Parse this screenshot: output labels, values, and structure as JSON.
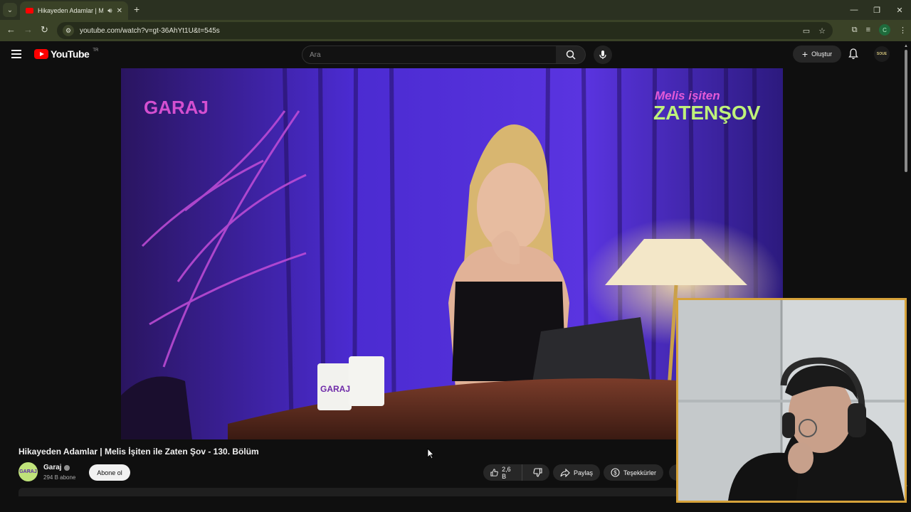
{
  "browser": {
    "tab_title": "Hikayeden Adamlar | Melis",
    "new_tab_icon": "plus-icon",
    "url": "youtube.com/watch?v=gt-36AhYt1U&t=545s",
    "profile_initial": "C"
  },
  "youtube": {
    "logo_text": "YouTube",
    "country_code": "TR",
    "search_placeholder": "Ara",
    "create_label": "Oluştur",
    "account_avatar_text": "SOUE",
    "brand_color": "#ff0000"
  },
  "video": {
    "overlay_left": "GARAJ",
    "overlay_right_top": "Melis işiten",
    "overlay_right_bottom": "ZATENŞOV",
    "mug_text": "GARAJ",
    "title": "Hikayeden Adamlar | Melis İşiten ile Zaten Şov - 130. Bölüm"
  },
  "channel": {
    "avatar_text": "GARAJ",
    "name": "Garaj",
    "subscribers": "294 B abone",
    "subscribe_label": "Abone ol"
  },
  "actions": {
    "like_count": "2,6 B",
    "share_label": "Paylaş",
    "thanks_label": "Teşekkürler"
  },
  "colors": {
    "page_bg": "#0f0f0f",
    "browser_frame": "#2b3121",
    "webcam_border": "#d6a23a"
  }
}
